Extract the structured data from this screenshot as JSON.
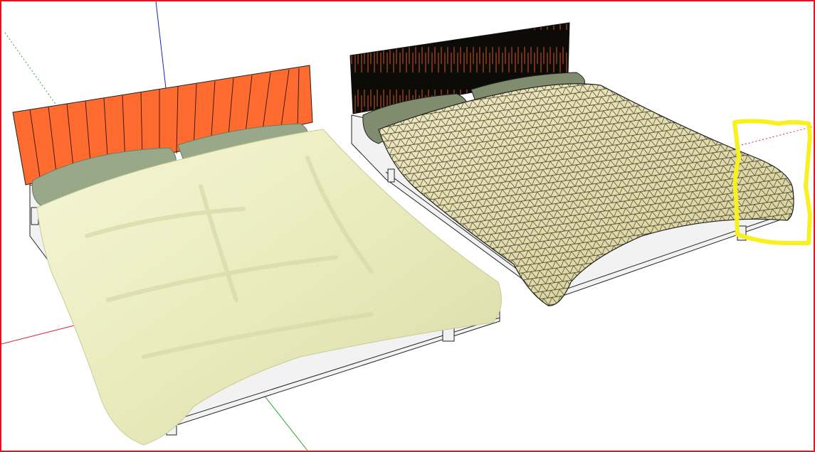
{
  "window": {
    "title": "",
    "border_color": "#e8141c"
  },
  "viewport": {
    "background": "#ffffff",
    "axes": {
      "red_axis_color": "#d9262b",
      "green_axis_color": "#2aa52a",
      "blue_axis_color": "#1c22b8"
    }
  },
  "models": [
    {
      "id": "bed-left",
      "render_style": "smooth-shaded",
      "headboard_color": "#ff6a2f",
      "sheet_color": "#eef0c2",
      "pillow_color": "#9aa88a",
      "frame_color": "#f2f2f2"
    },
    {
      "id": "bed-right",
      "render_style": "wireframe-mesh",
      "headboard_color": "#0d0b08",
      "sheet_color": "#e9e3b4",
      "pillow_color": "#7f8c6d",
      "frame_color": "#f2f2f2"
    }
  ],
  "annotation": {
    "shape": "bracket",
    "color": "#f7f11f"
  }
}
